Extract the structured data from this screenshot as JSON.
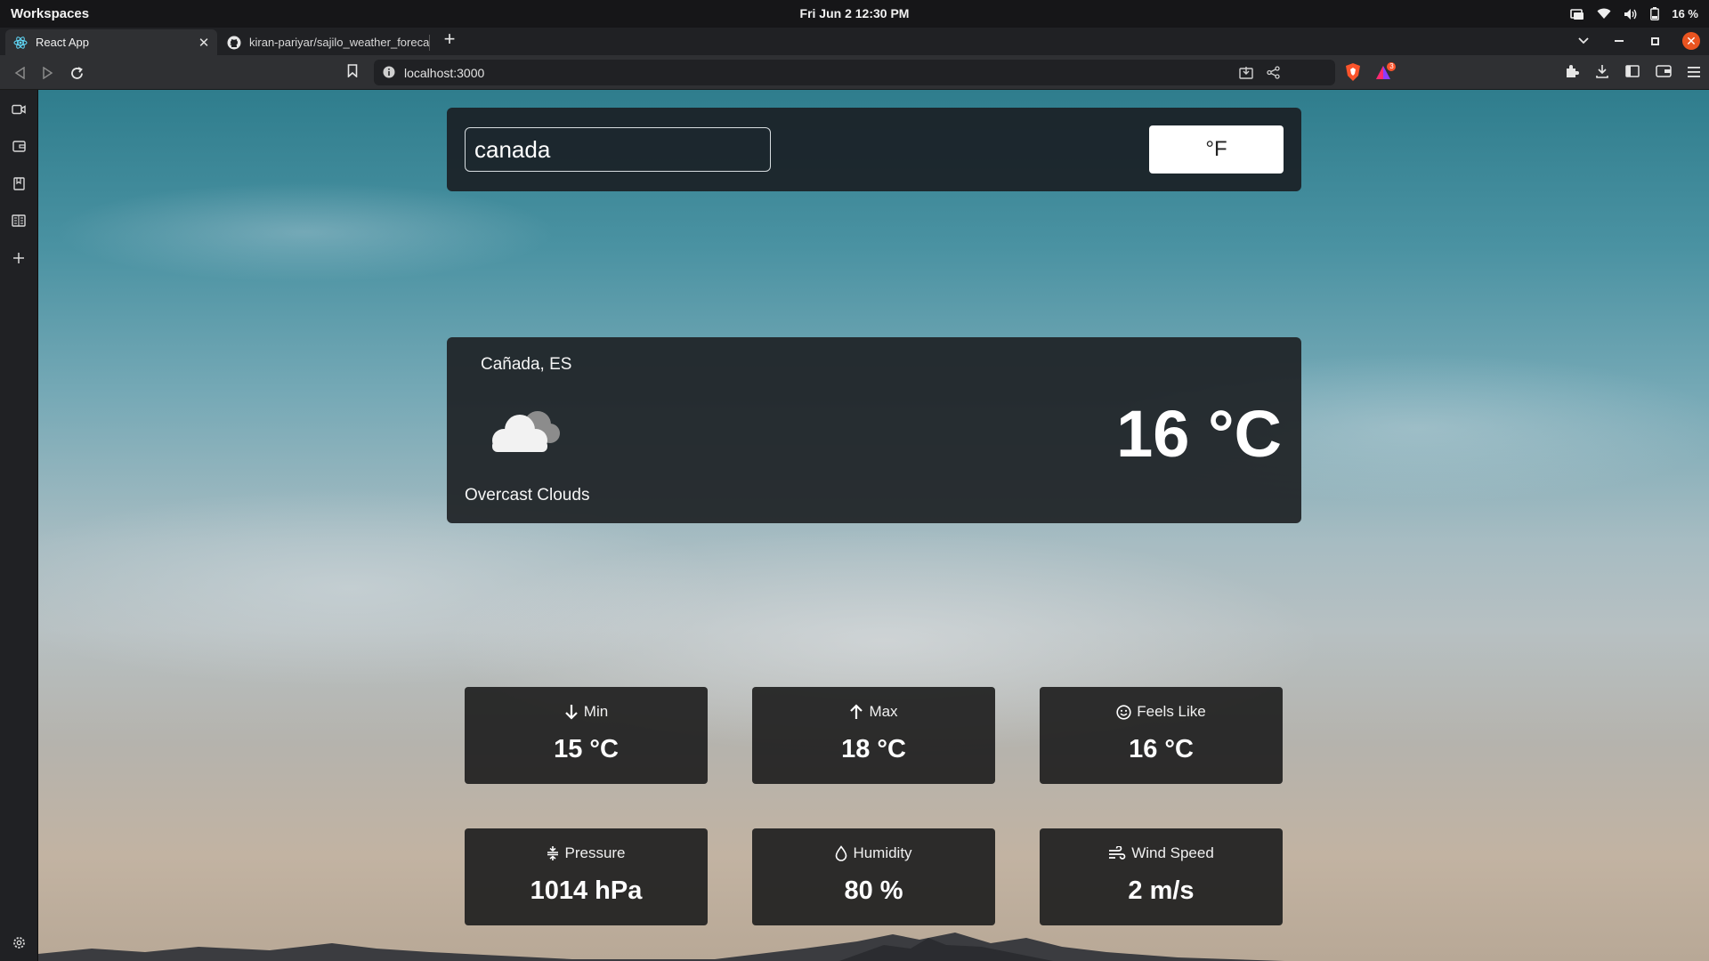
{
  "os": {
    "workspaces_label": "Workspaces",
    "clock": "Fri Jun 2  12:30 PM",
    "battery": "16 %"
  },
  "tabs": [
    {
      "title": "React App",
      "active": true
    },
    {
      "title": "kiran-pariyar/sajilo_weather_forecast",
      "active": false
    }
  ],
  "address_bar": {
    "url": "localhost:3000",
    "shield_badge_count": "3"
  },
  "app": {
    "search": {
      "value": "canada",
      "placeholder": ""
    },
    "unit_toggle_label": "°F",
    "current": {
      "city": "Cañada, ES",
      "description": "Overcast Clouds",
      "temperature": "16 °C",
      "icon": "overcast-clouds-icon"
    },
    "stats": [
      {
        "label": "Min",
        "value": "15 °C",
        "icon": "arrow-down-icon"
      },
      {
        "label": "Max",
        "value": "18 °C",
        "icon": "arrow-up-icon"
      },
      {
        "label": "Feels Like",
        "value": "16 °C",
        "icon": "smile-icon"
      },
      {
        "label": "Pressure",
        "value": "1014 hPa",
        "icon": "compress-icon"
      },
      {
        "label": "Humidity",
        "value": "80 %",
        "icon": "droplet-icon"
      },
      {
        "label": "Wind Speed",
        "value": "2 m/s",
        "icon": "wind-icon"
      }
    ]
  },
  "colors": {
    "accent_close": "#e95420",
    "card_bg": "#1e2225",
    "brave_orange": "#fb542b"
  }
}
